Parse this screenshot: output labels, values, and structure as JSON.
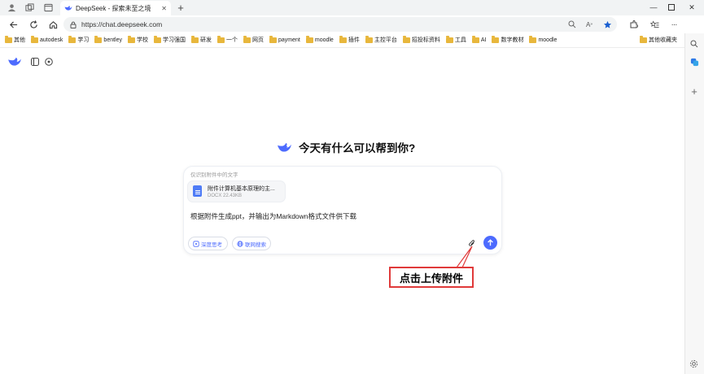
{
  "browser": {
    "tab_title": "DeepSeek - 探索未至之境",
    "url": "https://chat.deepseek.com"
  },
  "bookmarks": [
    "其他",
    "autodesk",
    "学习",
    "bentley",
    "学校",
    "学习强国",
    "研发",
    "一个",
    "网页",
    "payment",
    "moodle",
    "插件",
    "主控平台",
    "招投标资料",
    "工具",
    "AI",
    "数字教材",
    "moodle"
  ],
  "bookmarks_other": "其他收藏夹",
  "page": {
    "heading": "今天有什么可以帮到你?",
    "context_label": "仅识别附件中的文字",
    "file": {
      "name": "附件计算机基本原理的主...",
      "meta": "DOCX 22.43KB"
    },
    "prompt_text": "根据附件生成ppt，并输出为Markdown格式文件供下载",
    "chips": {
      "deep_think": "深度思考",
      "web_search": "联网搜索"
    }
  },
  "annotation": {
    "label": "点击上传附件",
    "color": "#e03a3a"
  },
  "colors": {
    "accent": "#4d6bfe",
    "folder": "#e8b73c"
  },
  "icons": [
    "profile-icon",
    "workspaces-icon",
    "tab-actions-icon",
    "deepseek-logo-icon",
    "close-icon",
    "new-tab-icon",
    "back-icon",
    "refresh-icon",
    "home-icon",
    "lock-icon",
    "zoom-icon",
    "read-aloud-icon",
    "favorite-star-icon",
    "extensions-icon",
    "favorites-icon",
    "more-icon",
    "sidebar-toggle-icon",
    "new-chat-icon",
    "paperclip-icon",
    "send-arrow-icon",
    "search-sidebar-icon",
    "copilot-icon",
    "add-icon",
    "settings-icon"
  ]
}
